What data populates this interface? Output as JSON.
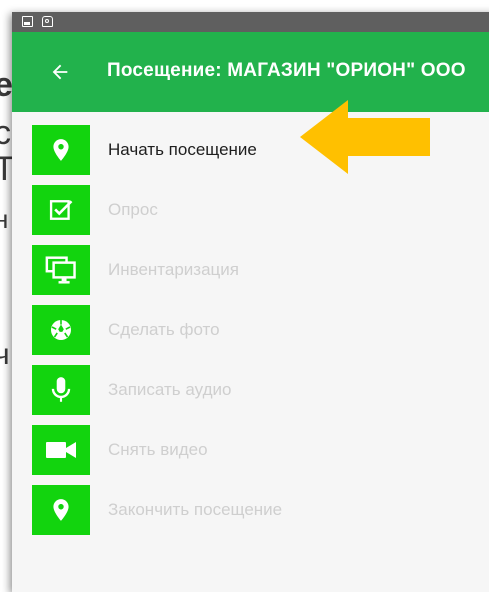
{
  "background_page": {
    "fragments": [
      "е",
      "с",
      "Т",
      "н",
      "ч"
    ]
  },
  "status_bar": {
    "icons": [
      "image-icon",
      "recycle-icon"
    ]
  },
  "app_bar": {
    "back_icon": "arrow-left-icon",
    "title": "Посещение: МАГАЗИН \"ОРИОН\" ООО"
  },
  "colors": {
    "app_bar": "#22b24c",
    "icon_tile": "#12d40e",
    "arrow": "#ffc000",
    "label_active": "#1e1e1e",
    "label_disabled": "#cfcfcf"
  },
  "menu": {
    "items": [
      {
        "label": "Начать посещение",
        "icon": "location-pin-icon",
        "enabled": true
      },
      {
        "label": "Опрос",
        "icon": "checkbox-icon",
        "enabled": false
      },
      {
        "label": "Инвентаризация",
        "icon": "monitors-icon",
        "enabled": false
      },
      {
        "label": "Сделать фото",
        "icon": "camera-aperture-icon",
        "enabled": false
      },
      {
        "label": "Записать аудио",
        "icon": "microphone-icon",
        "enabled": false
      },
      {
        "label": "Снять видео",
        "icon": "video-camera-icon",
        "enabled": false
      },
      {
        "label": "Закончить посещение",
        "icon": "location-pin-icon",
        "enabled": false
      }
    ]
  },
  "annotation": {
    "arrow_icon": "arrow-left-icon",
    "points_to": "Начать посещение"
  }
}
